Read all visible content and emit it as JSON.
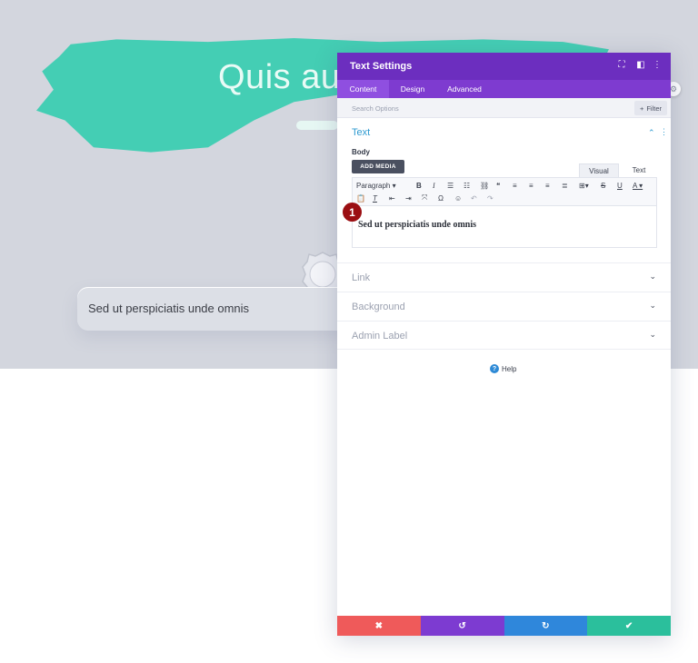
{
  "hero": {
    "title": "Quis au",
    "pill_text": "Sed ut perspiciatis unde omnis"
  },
  "panel": {
    "title": "Text Settings",
    "header_icons": [
      "expand-icon",
      "split-view-icon",
      "more-options-icon"
    ],
    "tabs": [
      {
        "label": "Content",
        "active": true
      },
      {
        "label": "Design",
        "active": false
      },
      {
        "label": "Advanced",
        "active": false
      }
    ],
    "search_placeholder": "Search Options",
    "filter_label": "Filter",
    "section_text": "Text",
    "body_label": "Body",
    "add_media_label": "ADD MEDIA",
    "editor_tabs": {
      "visual": "Visual",
      "text": "Text"
    },
    "paragraph_label": "Paragraph",
    "editor_content": "Sed ut perspiciatis unde omnis",
    "marker_number": "1",
    "sections": [
      {
        "label": "Link"
      },
      {
        "label": "Background"
      },
      {
        "label": "Admin Label"
      }
    ],
    "help_label": "Help",
    "footer_colors": [
      "#ef5a5a",
      "#7d3bd1",
      "#2f87db",
      "#2bbf9c"
    ]
  },
  "colors": {
    "header": "#6c2ebf",
    "tabs": "#7e3bd0",
    "accent_teal": "#3ccdb1",
    "section_blue": "#2e9ad0",
    "marker_red": "#9b0e12"
  }
}
